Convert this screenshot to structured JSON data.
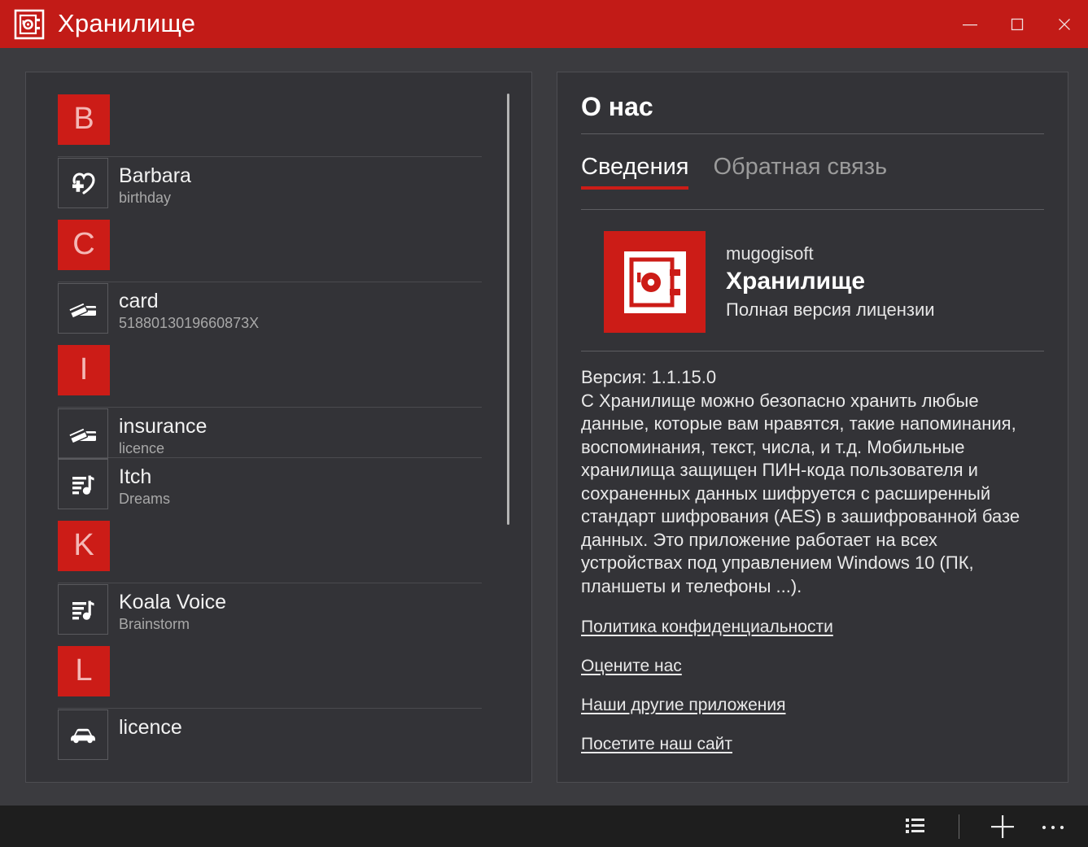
{
  "window": {
    "title": "Хранилище",
    "icon": "safe-vault-icon",
    "accent_color": "#c21b17",
    "controls": {
      "minimize": "minimize-icon",
      "maximize": "maximize-icon",
      "close": "close-icon"
    }
  },
  "left_panel": {
    "scrollbar_visible": true,
    "items": [
      {
        "type": "group",
        "label": "B"
      },
      {
        "type": "entry",
        "icon": "heart-plus-icon",
        "title": "Barbara",
        "subtitle": "birthday"
      },
      {
        "type": "group",
        "label": "C"
      },
      {
        "type": "entry",
        "icon": "credit-cards-icon",
        "title": "card",
        "subtitle": "5188013019660873X"
      },
      {
        "type": "group",
        "label": "I"
      },
      {
        "type": "entry",
        "icon": "credit-cards-icon",
        "title": "insurance",
        "subtitle": "licence"
      },
      {
        "type": "entry",
        "icon": "playlist-music-icon",
        "title": "Itch",
        "subtitle": "Dreams"
      },
      {
        "type": "group",
        "label": "K"
      },
      {
        "type": "entry",
        "icon": "playlist-music-icon",
        "title": "Koala Voice",
        "subtitle": "Brainstorm"
      },
      {
        "type": "group",
        "label": "L"
      },
      {
        "type": "entry",
        "icon": "car-icon",
        "title": "licence",
        "subtitle": ""
      }
    ]
  },
  "right_panel": {
    "title": "О нас",
    "tabs": [
      {
        "label": "Сведения",
        "active": true
      },
      {
        "label": "Обратная связь",
        "active": false
      }
    ],
    "app": {
      "logo": "safe-vault-icon",
      "publisher": "mugogisoft",
      "name": "Хранилище",
      "license": "Полная версия лицензии"
    },
    "version_line": "Версия: 1.1.15.0",
    "description": "С Хранилище можно безопасно хранить любые данные, которые вам нравятся, такие напоминания, воспоминания, текст, числа, и т.д. Мобильные хранилища защищен ПИН-кода пользователя и сохраненных данных шифруется с расширенный стандарт шифрования (AES) в зашифрованной базе данных. Это приложение работает на всех устройствах под управлением Windows 10 (ПК, планшеты и телефоны ...).",
    "links": [
      "Политика конфиденциальности",
      "Оцените нас",
      "Наши другие приложения",
      "Посетите наш сайт"
    ]
  },
  "command_bar": {
    "buttons": [
      {
        "name": "list-view-button",
        "icon": "list-icon"
      },
      {
        "name": "add-button",
        "icon": "plus-icon"
      },
      {
        "name": "more-button",
        "icon": "ellipsis-icon"
      }
    ]
  }
}
